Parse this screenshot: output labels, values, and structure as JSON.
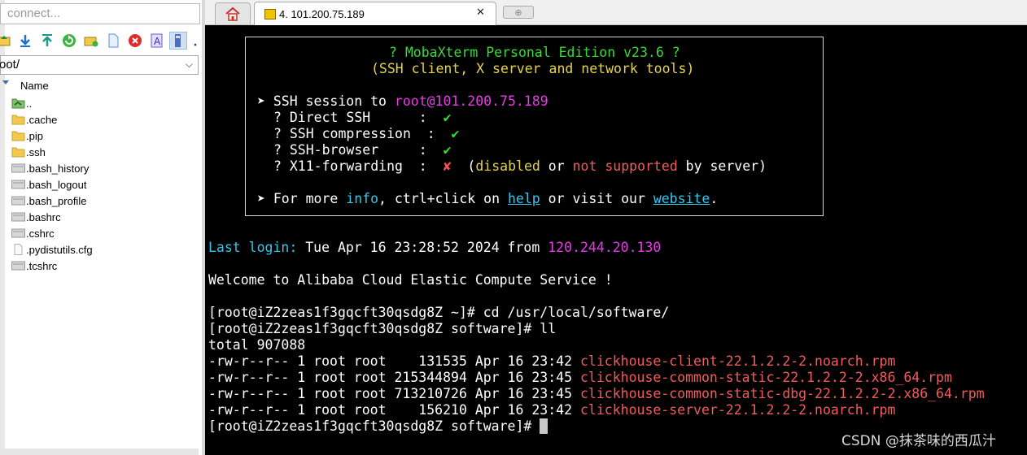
{
  "left": {
    "quick_connect_placeholder": "connect...",
    "path": "root/",
    "column_name": "Name",
    "files": [
      {
        "name": "..",
        "icon": "parent-folder-icon"
      },
      {
        "name": ".cache",
        "icon": "folder-icon"
      },
      {
        "name": ".pip",
        "icon": "folder-icon"
      },
      {
        "name": ".ssh",
        "icon": "folder-icon"
      },
      {
        "name": ".bash_history",
        "icon": "file-icon"
      },
      {
        "name": ".bash_logout",
        "icon": "file-icon"
      },
      {
        "name": ".bash_profile",
        "icon": "file-icon"
      },
      {
        "name": ".bashrc",
        "icon": "file-icon"
      },
      {
        "name": ".cshrc",
        "icon": "file-icon"
      },
      {
        "name": ".pydistutils.cfg",
        "icon": "text-file-icon"
      },
      {
        "name": ".tcshrc",
        "icon": "file-icon"
      }
    ]
  },
  "tabs": {
    "session_label": "4. 101.200.75.189",
    "close_glyph": "✕",
    "new_tab_glyph": "⊕"
  },
  "terminal": {
    "banner": {
      "title": "? MobaXterm Personal Edition v23.6 ?",
      "subtitle": "(SSH client, X server and network tools)",
      "session_prefix": "➤ SSH session to ",
      "session_target": "root@101.200.75.189",
      "features": [
        {
          "label": "? Direct SSH      :  ",
          "mark": "✔",
          "ok": true
        },
        {
          "label": "? SSH compression  :  ",
          "mark": "✔",
          "ok": true
        },
        {
          "label": "? SSH-browser     :  ",
          "mark": "✔",
          "ok": true
        },
        {
          "label": "? X11-forwarding  :  ",
          "mark": "✘",
          "ok": false
        }
      ],
      "x11_note": {
        "open": "  (",
        "disabled": "disabled",
        "or": " or ",
        "not_supported": "not supported",
        "by_server": " by server)"
      },
      "more": {
        "p1": "➤ For more ",
        "info": "info",
        "p2": ", ctrl+click on ",
        "help": "help",
        "p3": " or visit our ",
        "website": "website",
        "p4": "."
      }
    },
    "last_login": {
      "label": "Last login:",
      "date": " Tue Apr 16 23:28:52 2024 from ",
      "ip": "120.244.20.130"
    },
    "welcome": "Welcome to Alibaba Cloud Elastic Compute Service !",
    "prompt1": "[root@iZ2zeas1f3gqcft30qsdg8Z ~]# cd /usr/local/software/",
    "prompt2": "[root@iZ2zeas1f3gqcft30qsdg8Z software]# ll",
    "total": "total 907088",
    "listing": [
      {
        "meta": "-rw-r--r-- 1 root root    131535 Apr 16 23:42 ",
        "file": "clickhouse-client-22.1.2.2-2.noarch.rpm"
      },
      {
        "meta": "-rw-r--r-- 1 root root 215344894 Apr 16 23:45 ",
        "file": "clickhouse-common-static-22.1.2.2-2.x86_64.rpm"
      },
      {
        "meta": "-rw-r--r-- 1 root root 713210726 Apr 16 23:45 ",
        "file": "clickhouse-common-static-dbg-22.1.2.2-2.x86_64.rpm"
      },
      {
        "meta": "-rw-r--r-- 1 root root    156210 Apr 16 23:42 ",
        "file": "clickhouse-server-22.1.2.2-2.noarch.rpm"
      }
    ],
    "prompt3": "[root@iZ2zeas1f3gqcft30qsdg8Z software]# ",
    "watermark": "CSDN @抹茶味的西瓜汁"
  },
  "colors": {
    "terminal_bg": "#000000",
    "green": "#33dd33",
    "yellow": "#e5d44a",
    "cyan": "#33c8f0",
    "magenta": "#e53ce5",
    "red": "#f35b5b",
    "folder": "#f2c94c"
  }
}
